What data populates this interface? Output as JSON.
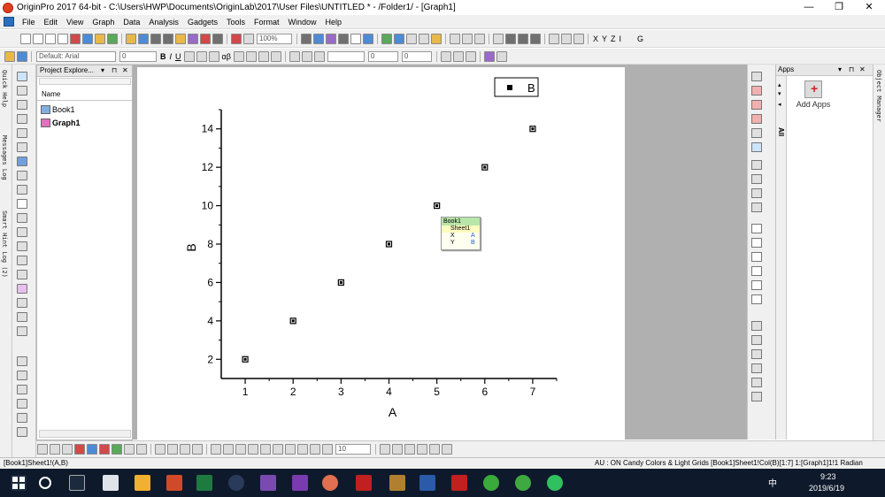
{
  "window": {
    "title": "OriginPro 2017 64-bit - C:\\Users\\HWP\\Documents\\OriginLab\\2017\\User Files\\UNTITLED * - /Folder1/ - [Graph1]",
    "minimize": "—",
    "restore": "❐",
    "close": "✕"
  },
  "menu": [
    "File",
    "Edit",
    "View",
    "Graph",
    "Data",
    "Analysis",
    "Gadgets",
    "Tools",
    "Format",
    "Window",
    "Help"
  ],
  "toolbar1": {
    "zoom": "100%",
    "axis_buttons": [
      "X",
      "Y",
      "Z",
      "I",
      "G"
    ]
  },
  "toolbar2": {
    "font": "Default: Arial",
    "font_size": "0",
    "bold": "B",
    "italic": "I",
    "underline": "U",
    "greek": "αβ",
    "line_width": "0",
    "size_field": "0"
  },
  "left_tabs": [
    "Quick Help",
    "Messages Log",
    "Smart Hint Log (2)"
  ],
  "project_explorer": {
    "title": "Project Explore...",
    "column_name": "Name",
    "items": [
      {
        "label": "Book1",
        "icon": "workbook-icon",
        "bold": false
      },
      {
        "label": "Graph1",
        "icon": "graph-icon",
        "bold": true
      }
    ]
  },
  "apps_panel": {
    "title": "Apps",
    "tab": "All",
    "add_apps": "Add Apps"
  },
  "object_manager": "Object Manager",
  "chart_data": {
    "type": "scatter",
    "x": [
      1,
      2,
      3,
      4,
      5,
      6,
      7
    ],
    "series": [
      {
        "name": "B",
        "values": [
          2,
          4,
          6,
          8,
          10,
          12,
          14
        ]
      }
    ],
    "xlabel": "A",
    "ylabel": "B",
    "xlim": [
      0.5,
      7.5
    ],
    "ylim": [
      1,
      15
    ],
    "xticks": [
      1,
      2,
      3,
      4,
      5,
      6,
      7
    ],
    "yticks": [
      2,
      4,
      6,
      8,
      10,
      12,
      14
    ],
    "legend_position": "top-right",
    "grid": false,
    "marker": "square",
    "marker_color": "#000000"
  },
  "data_tooltip": {
    "book": "Book1",
    "sheet": "Sheet1",
    "x_label": "X",
    "x_value": "A",
    "y_label": "Y",
    "y_value": "B"
  },
  "bottom_toolbar": {
    "size_field": "10"
  },
  "status": {
    "left": "[Book1]Sheet1!(A,B)",
    "right": "AU : ON  Candy Colors & Light Grids  [Book1]Sheet1!Col(B)[1:7]  1:[Graph1]1!1  Radian"
  },
  "taskbar": {
    "time": "9:23",
    "date": "2019/6/19",
    "ime": "中"
  }
}
